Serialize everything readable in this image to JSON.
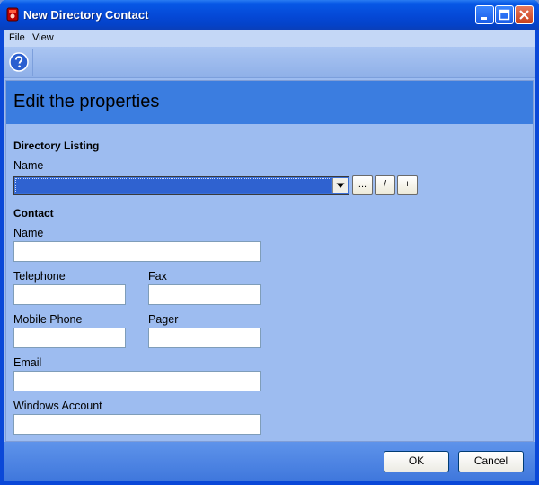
{
  "window": {
    "title": "New Directory Contact"
  },
  "menu": {
    "items": [
      "File",
      "View"
    ]
  },
  "toolbar": {
    "help_icon": "help-icon"
  },
  "panel": {
    "title": "Edit the properties"
  },
  "directory_listing": {
    "section": "Directory Listing",
    "name_label": "Name",
    "name_value": "",
    "browse_label": "...",
    "edit_label": "/",
    "add_label": "+"
  },
  "contact": {
    "section": "Contact",
    "name_label": "Name",
    "telephone_label": "Telephone",
    "fax_label": "Fax",
    "mobile_label": "Mobile Phone",
    "pager_label": "Pager",
    "email_label": "Email",
    "windows_account_label": "Windows Account"
  },
  "footer": {
    "ok_label": "OK",
    "cancel_label": "Cancel"
  },
  "colors": {
    "title_bar": "#0548d6",
    "panel_header": "#3b7de0",
    "client_bg": "#9dbcf0"
  }
}
